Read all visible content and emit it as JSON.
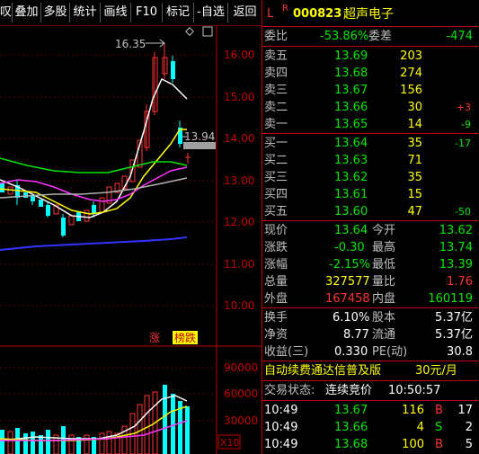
{
  "toolbar": {
    "items": [
      "叹",
      "叠加",
      "多股",
      "统计",
      "画线",
      "F10",
      "标记",
      "-自选",
      "返回"
    ]
  },
  "chart": {
    "price_axis": [
      "16.00",
      "15.00",
      "14.00",
      "13.00",
      "12.00",
      "11.00",
      "10.00"
    ],
    "high_label": "16.35",
    "last_label": "13.94",
    "tag_up": "涨",
    "tag_rank": "榜跌",
    "vol_axis": [
      "90000",
      "60000",
      "30000"
    ],
    "vol_unit": "X10"
  },
  "header": {
    "flag_l": "L",
    "flag_r": "R",
    "code": "000823",
    "name": "超声电子"
  },
  "ratio": {
    "label": "委比",
    "value": "-53.86%",
    "diff_label": "委差",
    "diff": "-474"
  },
  "sell": [
    {
      "label": "卖五",
      "price": "13.69",
      "vol": "203",
      "chg": ""
    },
    {
      "label": "卖四",
      "price": "13.68",
      "vol": "274",
      "chg": ""
    },
    {
      "label": "卖三",
      "price": "13.67",
      "vol": "156",
      "chg": ""
    },
    {
      "label": "卖二",
      "price": "13.66",
      "vol": "30",
      "chg": "+3"
    },
    {
      "label": "卖一",
      "price": "13.65",
      "vol": "14",
      "chg": "-9"
    }
  ],
  "buy": [
    {
      "label": "买一",
      "price": "13.64",
      "vol": "35",
      "chg": "-17"
    },
    {
      "label": "买二",
      "price": "13.63",
      "vol": "71",
      "chg": ""
    },
    {
      "label": "买三",
      "price": "13.62",
      "vol": "35",
      "chg": ""
    },
    {
      "label": "买四",
      "price": "13.61",
      "vol": "15",
      "chg": ""
    },
    {
      "label": "买五",
      "price": "13.60",
      "vol": "47",
      "chg": "-50"
    }
  ],
  "quote": [
    {
      "l1": "现价",
      "v1": "13.64",
      "l2": "今开",
      "v2": "13.62"
    },
    {
      "l1": "涨跌",
      "v1": "-0.30",
      "l2": "最高",
      "v2": "13.74"
    },
    {
      "l1": "涨幅",
      "v1": "-2.15%",
      "l2": "最低",
      "v2": "13.39"
    },
    {
      "l1": "总量",
      "v1": "327577",
      "l2": "量比",
      "v2": "1.76"
    },
    {
      "l1": "外盘",
      "v1": "167458",
      "l2": "内盘",
      "v2": "160119"
    }
  ],
  "fund": [
    {
      "l1": "换手",
      "v1": "6.10%",
      "l2": "股本",
      "v2": "5.37亿"
    },
    {
      "l1": "净资",
      "v1": "8.77",
      "l2": "流通",
      "v2": "5.37亿"
    },
    {
      "l1": "收益(三)",
      "v1": "0.330",
      "l2": "PE(动)",
      "v2": "30.8"
    }
  ],
  "promo": {
    "text": "自动续费通达信普及版",
    "price": "30元/月"
  },
  "status": {
    "label": "交易状态:",
    "value": "连续竞价",
    "time": "10:50:57"
  },
  "ticks": [
    {
      "time": "10:49",
      "price": "13.67",
      "vol": "116",
      "bs": "B",
      "n": "17"
    },
    {
      "time": "10:49",
      "price": "13.66",
      "vol": "4",
      "bs": "S",
      "n": "2"
    },
    {
      "time": "10:49",
      "price": "13.68",
      "vol": "100",
      "bs": "B",
      "n": "5"
    }
  ],
  "colors": {
    "up": "#ff3232",
    "down": "#00e600",
    "frame": "#c00000",
    "equal": "#ffff00"
  }
}
